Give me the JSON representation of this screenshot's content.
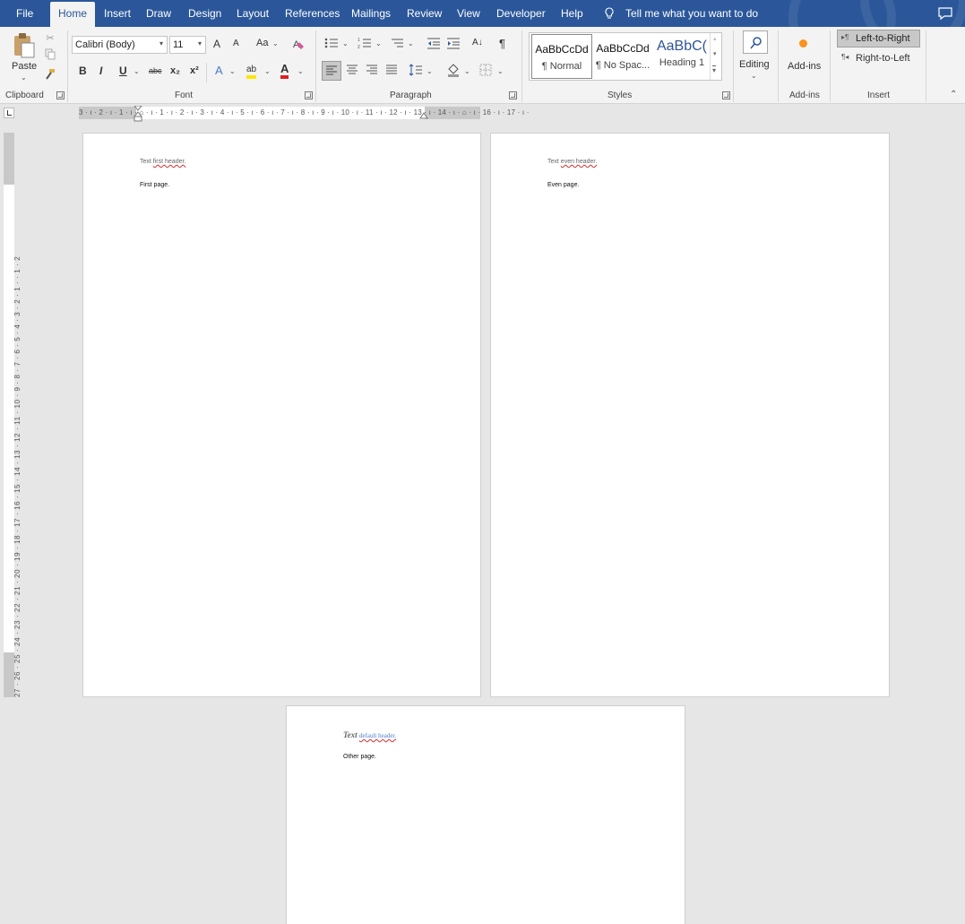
{
  "tabs": [
    {
      "label": "File",
      "active": false
    },
    {
      "label": "Home",
      "active": true
    },
    {
      "label": "Insert",
      "active": false
    },
    {
      "label": "Draw",
      "active": false
    },
    {
      "label": "Design",
      "active": false
    },
    {
      "label": "Layout",
      "active": false
    },
    {
      "label": "References",
      "active": false
    },
    {
      "label": "Mailings",
      "active": false
    },
    {
      "label": "Review",
      "active": false
    },
    {
      "label": "View",
      "active": false
    },
    {
      "label": "Developer",
      "active": false
    },
    {
      "label": "Help",
      "active": false
    }
  ],
  "tell_me": "Tell me what you want to do",
  "ribbon": {
    "clipboard": {
      "paste": "Paste",
      "label": "Clipboard"
    },
    "font": {
      "label": "Font",
      "family": "Calibri (Body)",
      "size": "11",
      "bold": "B",
      "italic": "I",
      "underline": "U",
      "strike": "abc",
      "sub": "x₂",
      "sup": "x²",
      "grow": "A",
      "shrink": "A",
      "case": "Aa",
      "effects": "A",
      "highlight": "ab",
      "color": "A"
    },
    "paragraph": {
      "label": "Paragraph",
      "sort": "A↓",
      "pilcrow": "¶"
    },
    "styles": {
      "label": "Styles",
      "items": [
        {
          "sample": "AaBbCcDd",
          "name": "¶ Normal"
        },
        {
          "sample": "AaBbCcDd",
          "name": "¶ No Spac..."
        },
        {
          "sample": "AaBbC(",
          "name": "Heading 1"
        }
      ]
    },
    "editing": {
      "label": "Editing"
    },
    "addins": {
      "button": "Add-ins",
      "label": "Add-ins"
    },
    "insert": {
      "ltr": "Left-to-Right",
      "rtl": "Right-to-Left",
      "label": "Insert"
    }
  },
  "ruler": {
    "h_ticks": "3 · ı · 2 · ı · 1 · ı · ⌂ · ı · 1 · ı · 2 · ı · 3 · ı · 4 · ı · 5 · ı · 6 · ı · 7 · ı · 8 · ı · 9 · ı · 10 · ı · 11 · ı · 12 · ı · 13 · ı · 14 · ı · ⌂ · ı · 16 · ı · 17 · ı ·",
    "v_ticks": "27 · 26 · 25 · 24 · 23 · 22 · 21 · 20 · 19 · 18 · 17 · 16 · 15 · 14 · 13 · 12 · 11 · 10 · 9 · 8 · 7 · 6 · 5 · 4 · 3 · 2 · 1 · · 1 · 2"
  },
  "pages": [
    {
      "header_plain": "Text ",
      "header_marked": "first header.",
      "body": "First page."
    },
    {
      "header_plain": "Text ",
      "header_marked": "even header.",
      "body": "Even page."
    },
    {
      "header_plain": "Text ",
      "header_marked": "default header.",
      "body": "Other page."
    }
  ],
  "colors": {
    "brand": "#2b579a",
    "ribbon": "#f3f3f3",
    "canvas": "#e6e6e6",
    "accent_orange": "#f7931e"
  }
}
